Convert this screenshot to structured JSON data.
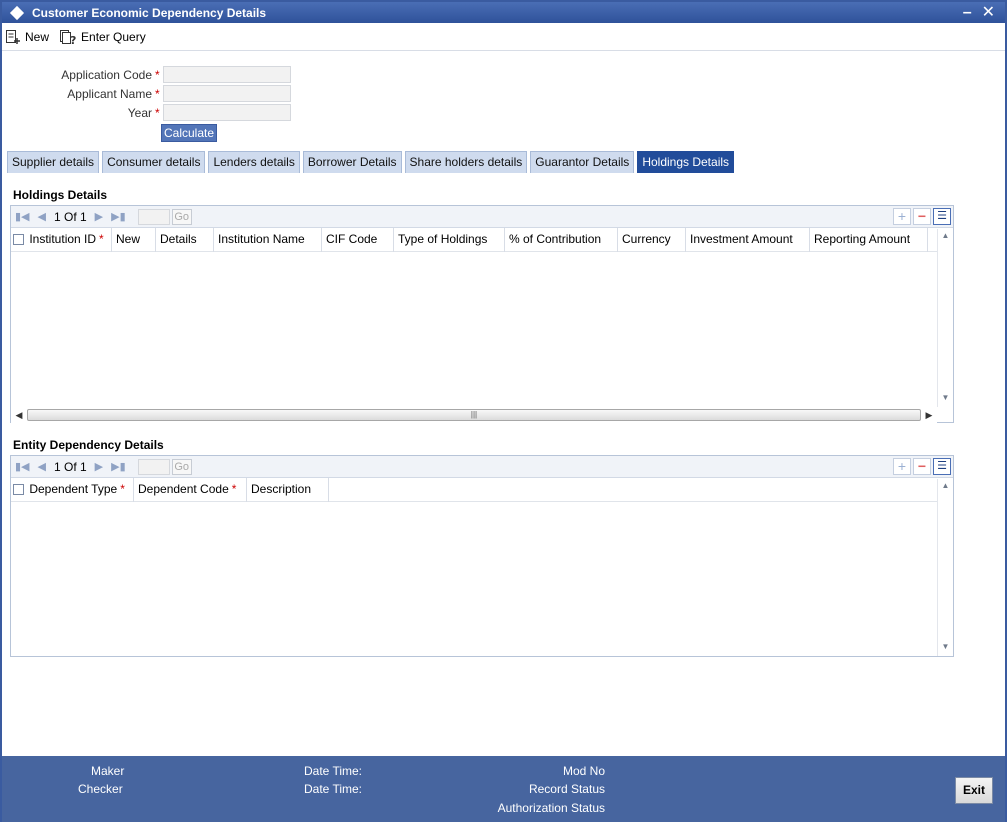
{
  "window": {
    "title": "Customer Economic Dependency Details"
  },
  "toolbar": {
    "new_label": "New",
    "enter_query_label": "Enter Query"
  },
  "form": {
    "application_code_label": "Application Code",
    "applicant_name_label": "Applicant Name",
    "year_label": "Year",
    "required_marker": "*",
    "calculate_label": "Calculate"
  },
  "tabs": [
    {
      "label": "Supplier details"
    },
    {
      "label": "Consumer details"
    },
    {
      "label": "Lenders details"
    },
    {
      "label": "Borrower Details"
    },
    {
      "label": "Share holders details"
    },
    {
      "label": "Guarantor Details"
    },
    {
      "label": "Holdings Details",
      "active": true
    }
  ],
  "holdings": {
    "title": "Holdings Details",
    "pager": "1 Of 1",
    "go_label": "Go",
    "columns": [
      {
        "label": "Institution ID",
        "required": true
      },
      {
        "label": "New"
      },
      {
        "label": "Details"
      },
      {
        "label": "Institution Name"
      },
      {
        "label": "CIF Code"
      },
      {
        "label": "Type of Holdings"
      },
      {
        "label": "% of Contribution"
      },
      {
        "label": "Currency"
      },
      {
        "label": "Investment Amount"
      },
      {
        "label": "Reporting Amount"
      }
    ]
  },
  "entity": {
    "title": "Entity Dependency Details",
    "pager": "1 Of 1",
    "go_label": "Go",
    "columns": [
      {
        "label": "Dependent Type",
        "required": true
      },
      {
        "label": "Dependent Code",
        "required": true
      },
      {
        "label": "Description"
      }
    ]
  },
  "footer": {
    "maker_label": "Maker",
    "checker_label": "Checker",
    "date_time_label_1": "Date Time:",
    "date_time_label_2": "Date Time:",
    "mod_no_label": "Mod No",
    "record_status_label": "Record Status",
    "authorization_status_label": "Authorization Status",
    "exit_label": "Exit"
  },
  "colors": {
    "titlebar": "#2f529a",
    "active_tab": "#214c9a",
    "footer": "#47659f",
    "required": "#cc0000"
  }
}
